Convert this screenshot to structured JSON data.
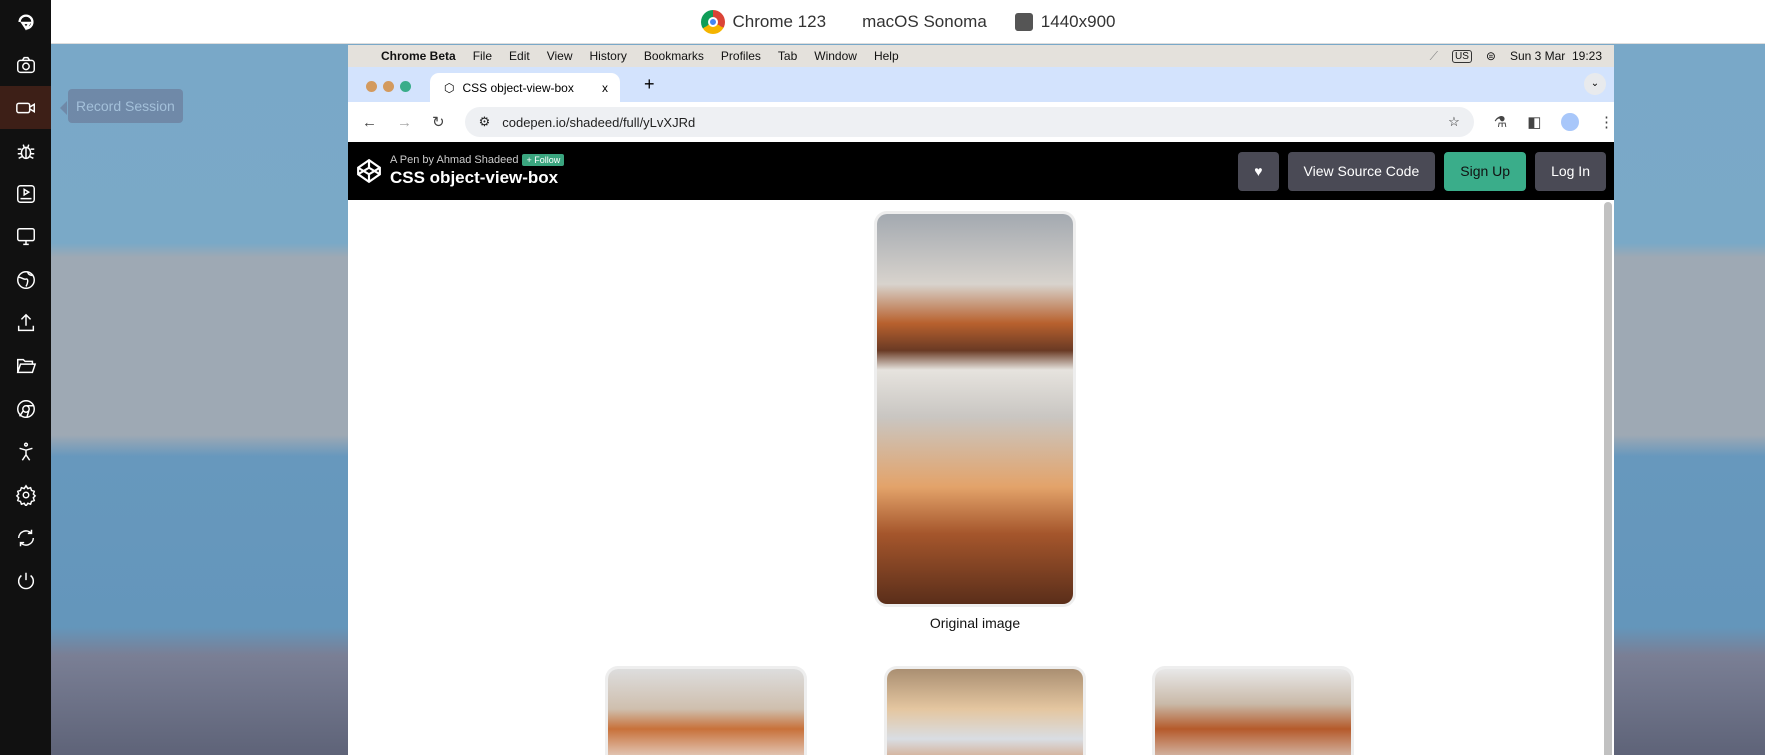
{
  "sidebar": {
    "items": [
      "logo",
      "camera",
      "record-session",
      "bug",
      "play-video",
      "screen",
      "globe",
      "upload",
      "folder",
      "chrome",
      "accessibility",
      "settings",
      "sync",
      "power"
    ],
    "active": "record-session"
  },
  "tooltip": "Record Session",
  "topbar": {
    "browser": "Chrome 123",
    "os": "macOS Sonoma",
    "resolution": "1440x900"
  },
  "menubar": {
    "app": "Chrome Beta",
    "items": [
      "File",
      "Edit",
      "View",
      "History",
      "Bookmarks",
      "Profiles",
      "Tab",
      "Window",
      "Help"
    ],
    "input": "US",
    "datetime": "Sun 3 Mar  19:23"
  },
  "tab": {
    "title": "CSS object-view-box",
    "close": "x",
    "new": "+"
  },
  "address": {
    "url": "codepen.io/shadeed/full/yLvXJRd"
  },
  "codepen": {
    "byline": "A Pen by Ahmad Shadeed",
    "follow": "+ Follow",
    "title": "CSS object-view-box",
    "heart": "♥",
    "view_source": "View Source Code",
    "signup": "Sign Up",
    "login": "Log In"
  },
  "content": {
    "caption": "Original image"
  }
}
